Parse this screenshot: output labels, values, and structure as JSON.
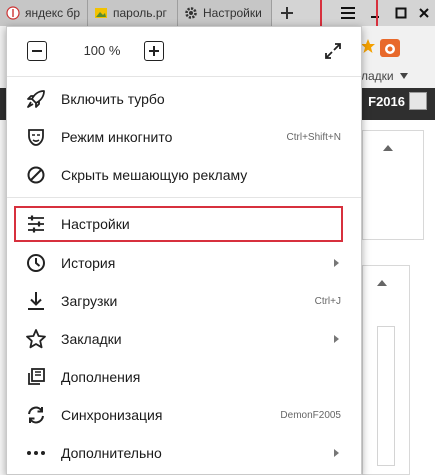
{
  "tabs": [
    {
      "label": "яндекс бр",
      "icon": "yandex-icon"
    },
    {
      "label": "пароль.рг",
      "icon": "image-icon"
    },
    {
      "label": "Настройки",
      "icon": "gear-icon"
    }
  ],
  "background": {
    "bookmarks_label": "ладки",
    "user_label": "F2016"
  },
  "zoom": {
    "value": "100 %"
  },
  "menu": {
    "items": [
      {
        "label": "Включить турбо",
        "icon": "rocket-icon",
        "shortcut": ""
      },
      {
        "label": "Режим инкогнито",
        "icon": "incognito-mask-icon",
        "shortcut": "Ctrl+Shift+N"
      },
      {
        "label": "Скрыть мешающую рекламу",
        "icon": "block-icon",
        "shortcut": ""
      },
      {
        "label": "Настройки",
        "icon": "sliders-icon",
        "shortcut": ""
      },
      {
        "label": "История",
        "icon": "clock-icon",
        "shortcut": ""
      },
      {
        "label": "Загрузки",
        "icon": "download-icon",
        "shortcut": "Ctrl+J"
      },
      {
        "label": "Закладки",
        "icon": "star-icon",
        "shortcut": ""
      },
      {
        "label": "Дополнения",
        "icon": "extensions-icon",
        "shortcut": ""
      },
      {
        "label": "Синхронизация",
        "icon": "sync-icon",
        "shortcut": "DemonF2005"
      },
      {
        "label": "Дополнительно",
        "icon": "more-dots-icon",
        "shortcut": ""
      }
    ]
  },
  "colors": {
    "highlight": "#d7303d",
    "tabstrip": "#d4d4d4",
    "dark_bar": "#2f2f2f"
  }
}
